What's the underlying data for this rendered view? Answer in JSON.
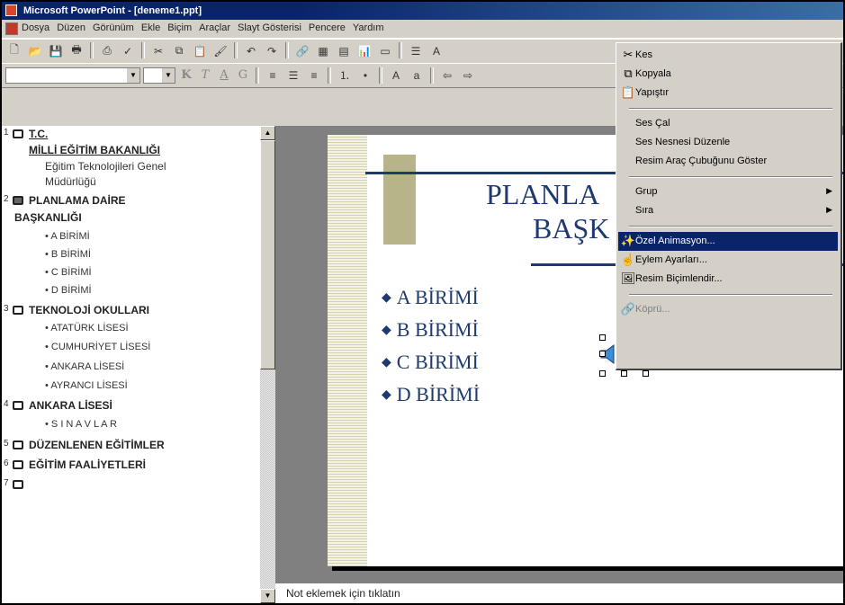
{
  "window": {
    "title": "Microsoft PowerPoint - [deneme1.ppt]"
  },
  "menubar": {
    "items": [
      "Dosya",
      "Düzen",
      "Görünüm",
      "Ekle",
      "Biçim",
      "Araçlar",
      "Slayt Gösterisi",
      "Pencere",
      "Yardım"
    ]
  },
  "format_toolbar": {
    "bold": "K",
    "italic": "T",
    "underline": "A",
    "shadow": "G"
  },
  "outline": {
    "slides": [
      {
        "num": "1",
        "title_line1": "T.C.",
        "title_line2": "MİLLİ EĞİTİM BAKANLIĞI",
        "subs": [
          "Eğitim Teknolojileri Genel",
          "Müdürlüğü"
        ],
        "bullets": []
      },
      {
        "num": "2",
        "title_line1": "PLANLAMA DAİRE",
        "title_line2": "BAŞKANLIĞI",
        "subs": [],
        "bullets": [
          "A BİRİMİ",
          "B BİRİMİ",
          "C BİRİMİ",
          "D BİRİMİ"
        ]
      },
      {
        "num": "3",
        "title_line1": "TEKNOLOJİ OKULLARI",
        "title_line2": "",
        "subs": [],
        "bullets": [
          "ATATÜRK LİSESİ",
          "CUMHURİYET LİSESİ",
          "ANKARA LİSESİ",
          "AYRANCI LİSESİ"
        ]
      },
      {
        "num": "4",
        "title_line1": "ANKARA  LİSESİ",
        "title_line2": "",
        "subs": [],
        "bullets": [
          "S I N A V L A R"
        ]
      },
      {
        "num": "5",
        "title_line1": "DÜZENLENEN EĞİTİMLER",
        "title_line2": "",
        "subs": [],
        "bullets": []
      },
      {
        "num": "6",
        "title_line1": "EĞİTİM FAALİYETLERİ",
        "title_line2": "",
        "subs": [],
        "bullets": []
      },
      {
        "num": "7",
        "title_line1": "",
        "title_line2": "",
        "subs": [],
        "bullets": []
      }
    ]
  },
  "slide": {
    "title_line1": "PLANLA",
    "title_line2": "BAŞK",
    "bullets": [
      "A BİRİMİ",
      "B BİRİMİ",
      "C BİRİMİ",
      "D BİRİMİ"
    ],
    "title_color": "#1e3a6e"
  },
  "notes": {
    "placeholder": "Not eklemek için tıklatın"
  },
  "context_menu": {
    "items": [
      {
        "label": "Kes",
        "icon": "scissors-icon",
        "state": "normal"
      },
      {
        "label": "Kopyala",
        "icon": "copy-icon",
        "state": "normal"
      },
      {
        "label": "Yapıştır",
        "icon": "paste-icon",
        "state": "normal"
      },
      {
        "label": "Ses Çal",
        "icon": "",
        "state": "normal"
      },
      {
        "label": "Ses Nesnesi Düzenle",
        "icon": "",
        "state": "normal"
      },
      {
        "label": "Resim Araç Çubuğunu Göster",
        "icon": "",
        "state": "normal"
      },
      {
        "label": "Grup",
        "icon": "",
        "state": "submenu"
      },
      {
        "label": "Sıra",
        "icon": "",
        "state": "submenu"
      },
      {
        "label": "Özel Animasyon...",
        "icon": "animation-icon",
        "state": "selected"
      },
      {
        "label": "Eylem Ayarları...",
        "icon": "action-icon",
        "state": "normal"
      },
      {
        "label": "Resim Biçimlendir...",
        "icon": "format-picture-icon",
        "state": "normal"
      },
      {
        "label": "Köprü...",
        "icon": "hyperlink-icon",
        "state": "disabled"
      }
    ],
    "highlight_color": "#0a246a"
  }
}
